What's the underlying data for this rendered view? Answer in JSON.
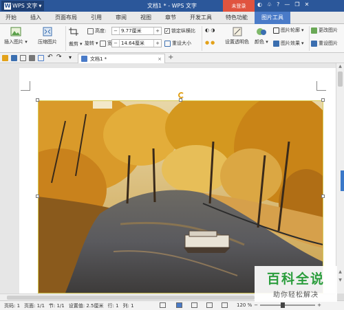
{
  "titlebar": {
    "app_name": "WPS 文字",
    "doc_title": "文档1 * - WPS 文字",
    "login_label": "未登录",
    "icons": [
      "skin-icon",
      "hat-icon",
      "help-icon",
      "minimize-icon",
      "restore-icon",
      "close-icon"
    ]
  },
  "tabs": [
    "开始",
    "插入",
    "页面布局",
    "引用",
    "审阅",
    "视图",
    "章节",
    "开发工具",
    "特色功能",
    "图片工具"
  ],
  "active_tab": "图片工具",
  "ribbon": {
    "insert_picture": "插入图片",
    "compress_picture": "压缩图片",
    "crop": "裁剪",
    "rotate": "旋转",
    "height_label": "高度:",
    "height_value": "9.77厘米",
    "width_label": "宽度:",
    "width_value": "14.64厘米",
    "lock_ratio": "锁定纵横比",
    "reset_size": "重设大小",
    "set_transparent": "设置透明色",
    "color": "颜色",
    "picture_outline": "图片轮廓",
    "picture_effect": "图片效果",
    "change_picture": "更改图片",
    "reset_picture": "重设图片"
  },
  "doc_tab": {
    "label": "文档1 *",
    "close": "×",
    "add": "+"
  },
  "status": {
    "page_num": "页码: 1",
    "page": "页面: 1/1",
    "section": "节: 1/1",
    "setting": "设置值: 2.5厘米",
    "row": "行: 1",
    "col": "列: 1",
    "zoom": "120 %"
  },
  "watermark": {
    "title": "百科全说",
    "subtitle": "助你轻松解决"
  },
  "colors": {
    "titlebar": "#2b579a",
    "active_tab": "#4a7bc8",
    "login": "#e0543f",
    "watermark_green": "#2a9d3c"
  }
}
